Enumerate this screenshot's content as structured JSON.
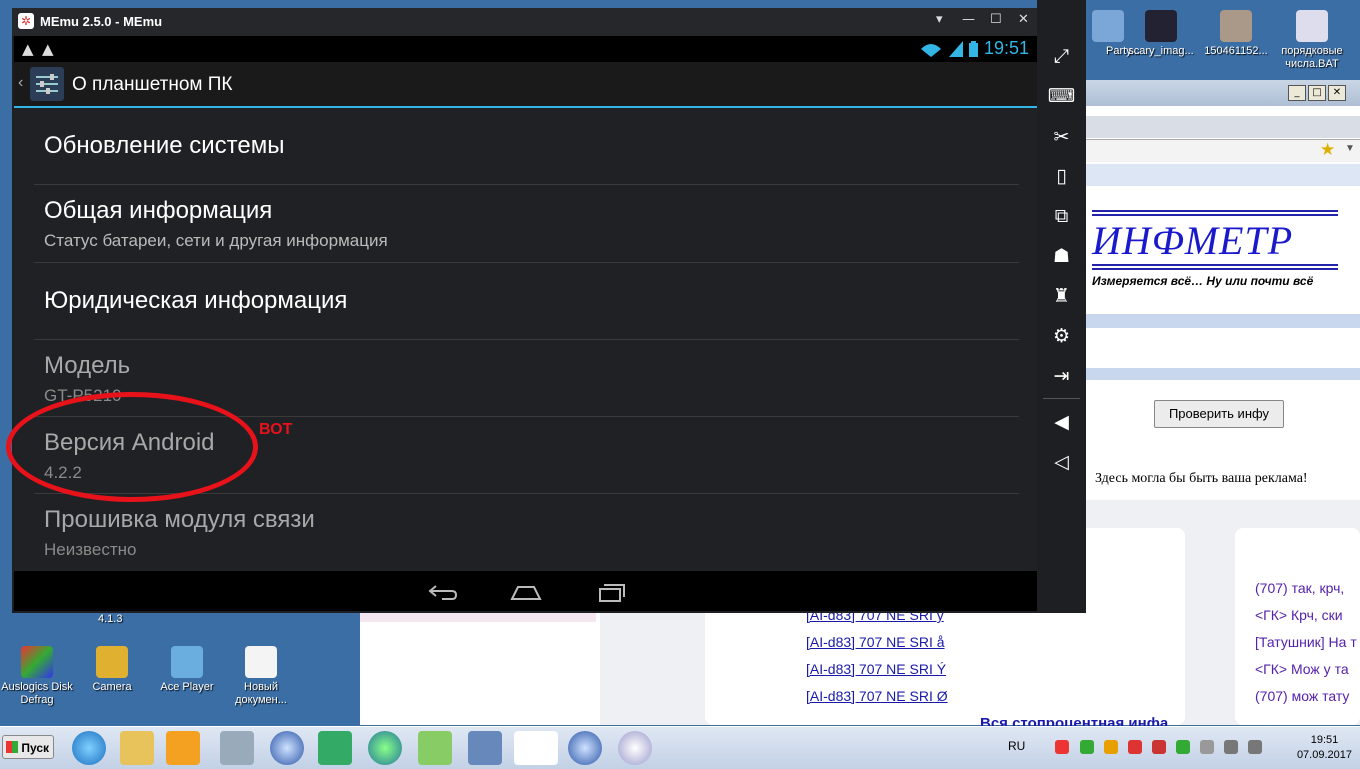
{
  "desktop": {
    "top_icons": [
      "Party...",
      "scary_imag...",
      "150461152...",
      "порядковые числа.BAT"
    ],
    "bottom_icons": [
      "Auslogics Disk Defrag",
      "Camera",
      "Ace Player",
      "Новый докумен..."
    ],
    "version_label": "4.1.3"
  },
  "browser": {
    "logo": "ИНФМЕТР",
    "tagline": "Измеряется всё… Ну или почти всё",
    "check_button": "Проверить инфу",
    "ad_text": "Здесь могла бы быть ваша реклама!",
    "left_links": [
      "[AI-d83] 707 NE SRI у",
      "[AI-d83] 707 NE SRI å",
      "[AI-d83] 707 NE SRI Ý",
      "[AI-d83] 707 NE SRI Ø"
    ],
    "right_links": [
      "(707) так, крч,",
      "<ГК> Крч, ски",
      "[Татушник] На т ...",
      "<ГК> Мож у та",
      "(707) мож тату"
    ],
    "bottom_heading": "Вся стопроцентная инфа"
  },
  "memu": {
    "title": "MEmu 2.5.0 - MEmu",
    "controls": [
      "▾",
      "—",
      "☐",
      "✕",
      "«"
    ]
  },
  "android": {
    "time": "19:51",
    "action_title": "О планшетном ПК",
    "items": [
      {
        "title": "Обновление системы",
        "subtitle": ""
      },
      {
        "title": "Общая информация",
        "subtitle": "Статус батареи, сети и другая информация"
      },
      {
        "title": "Юридическая информация",
        "subtitle": ""
      },
      {
        "title": "Модель",
        "subtitle": "GT-P5210"
      },
      {
        "title": "Версия Android",
        "subtitle": "4.2.2"
      },
      {
        "title": "Прошивка модуля связи",
        "subtitle": "Неизвестно"
      }
    ]
  },
  "annotation": {
    "label": "ВОТ",
    "color": "#e8121a"
  },
  "taskbar": {
    "start_label": "Пуск",
    "lang": "RU",
    "time": "19:51",
    "date": "07.09.2017"
  },
  "colors": {
    "accent": "#33b5e5",
    "desktop": "#3a6ea5"
  }
}
